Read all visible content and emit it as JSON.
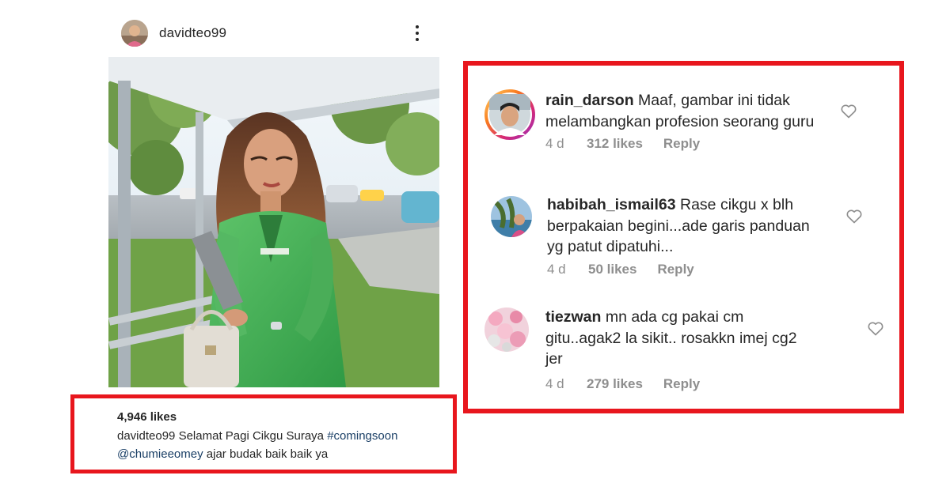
{
  "post": {
    "username": "davidteo99",
    "more_icon": "more-vertical-icon",
    "likes": "4,946 likes",
    "caption": {
      "user": "davidteo99",
      "text": "Selamat Pagi Cikgu Suraya",
      "hashtag": "#comingsoon",
      "mention": "@chumieeomey",
      "rest": "ajar budak baik baik ya"
    }
  },
  "comments": [
    {
      "user": "rain_darson",
      "lines": [
        "Maaf, gambar ini tidak",
        "melambangkan profesion seorang guru"
      ],
      "time": "4 d",
      "likes": "312 likes",
      "reply": "Reply"
    },
    {
      "user": "habibah_ismail63",
      "lines": [
        "Rase cikgu x blh",
        "berpakaian begini...ade garis panduan",
        "yg patut dipatuhi..."
      ],
      "time": "4 d",
      "likes": "50 likes",
      "reply": "Reply"
    },
    {
      "user": "tiezwan",
      "lines": [
        "mn ada cg pakai cm",
        "gitu..agak2 la sikit.. rosakkn imej cg2",
        "jer"
      ],
      "time": "4 d",
      "likes": "279 likes",
      "reply": "Reply"
    }
  ],
  "colors": {
    "highlight_frame": "#e8161d",
    "meta_text": "#8e8e8e",
    "hashtag": "#1a3f66",
    "story_ring": "#d6249f"
  }
}
